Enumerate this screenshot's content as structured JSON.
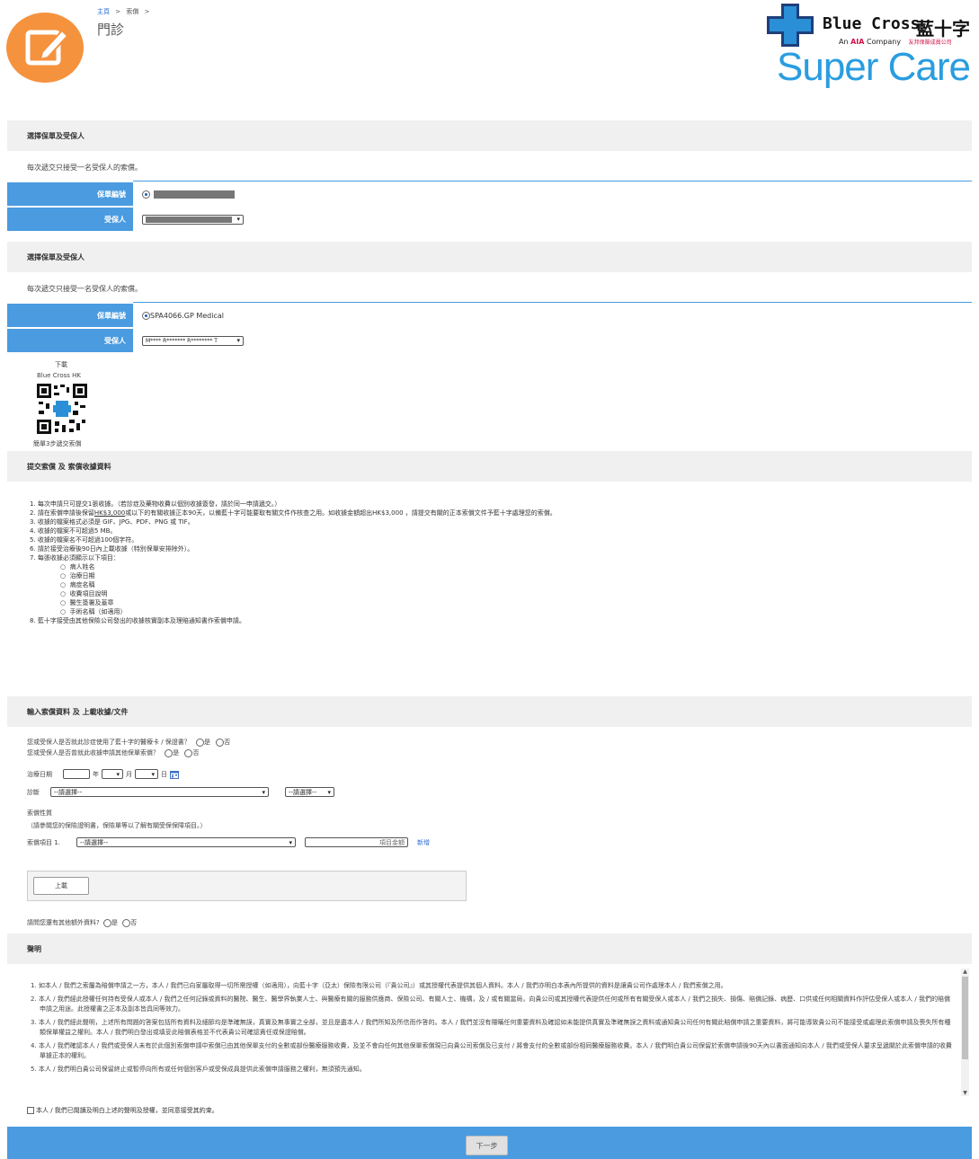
{
  "header": {
    "breadcrumb_home": "主頁",
    "breadcrumb_sep": ">",
    "breadcrumb_claims": "索償",
    "breadcrumb_sep2": ">",
    "page_title": "門診",
    "brand_name": "Blue Cross",
    "brand_cn": "藍十字",
    "brand_sub1": "An",
    "brand_sub_aia": "AIA",
    "brand_sub2": "Company",
    "brand_sub_cn": "友邦保險成員公司",
    "product": "Super Care"
  },
  "section1": {
    "heading": "選擇保單及受保人",
    "note": "每次遞交只接受一名受保人的索償。",
    "policy_label": "保單編號",
    "insured_label": "受保人"
  },
  "section2": {
    "heading": "選擇保單及受保人",
    "note": "每次遞交只接受一名受保人的索償。",
    "policy_label": "保單編號",
    "policy_value": "SPA4066.GP Medical",
    "insured_label": "受保人",
    "insured_value": "M**** R******* R******** T"
  },
  "app_promo": {
    "line1": "下載",
    "line2": "Blue Cross HK",
    "line3": "簡單3步遞交索償"
  },
  "section3": {
    "heading": "提交索償 及 索償收據資料",
    "items": [
      "1. 每次申請只可提交1張收據。（若診症及藥物收費以個別收據簽發，請於同一申請遞交。）",
      "3. 收據的檔案格式必須是 GIF、JPG、PDF、PNG 或 TIF。",
      "4. 收據的檔案不可超過5 MB。",
      "5. 收據的檔案名不可超過100個字符。",
      "6. 請於接受治療後90日內上載收據（特別保單安排除外）。",
      "7. 每張收據必須顯示以下項目："
    ],
    "item2_pre": "2. 請在索償申請後保留",
    "item2_link": "HK$3,000",
    "item2_post": "或以下的有關收據正本90天，以備藍十字可能要取有關文件作核查之用。如收據金額超出HK$3,000 ，請提交有關的正本索償文件予藍十字處理您的索償。",
    "subitems": [
      "病人姓名",
      "治療日期",
      "病症名稱",
      "收費項目說明",
      "醫生簽署及蓋章",
      "手術名稱（如適用）"
    ],
    "item8": "8. 藍十字接受由其他保險公司發出的收據核實副本及理賠通知書作索償申請。"
  },
  "section4": {
    "heading": "輸入索償資料 及 上載收據/文件",
    "q1": "您或受保人是否就此診症使用了藍十字的醫療卡 / 保證書？",
    "q2": "您或受保人是否曾就此收據申請其他保單索償？",
    "yes": "是",
    "no": "否",
    "date_label": "治療日期",
    "year": "年",
    "month": "月",
    "day": "日",
    "diagnosis_label": "診斷",
    "diag_placeholder": "--請選擇--",
    "diag2_placeholder": "--請選擇--",
    "claim_nature": "索償性質",
    "claim_hint": "（請參閱您的保險證明書，保險單等以了解有關受保保障項目。）",
    "claim_item_label": "索償項目 1.",
    "claim_item_placeholder": "--請選擇--",
    "amount_placeholder": "項目金額",
    "add_link": "新增",
    "upload": "上載",
    "extra_q": "請問您還有其他額外資料?",
    "extra_yes": "是",
    "extra_no": "否"
  },
  "section5": {
    "heading": "聲明",
    "paras": [
      "1. 如本人 / 我們之索屬為賠償申請之一方，本人 / 我們已向家屬取得一切所需授權（如適用），向藍十字（亞太）保險有限公司（『貴公司』）或其授權代表提供其個人資料。本人 / 我們亦明白本表內所提供的資料是讓貴公司作處理本人 / 我們索償之用。",
      "2. 本人 / 我們經此授權任何持有受保人或本人 / 我們之任何記錄或資料的醫院、醫生、醫學界執業人士、與醫療有關的服務供應商、保險公司、有關人士、機構，及 / 或有關當局，向貴公司或其授權代表提供任何或所有有關受保人或本人 / 我們之損失、損傷、賠償記錄、病歷、口供或任何相關資料作評估受保人或本人 / 我們的賠償申請之用途。此授權書之正本及副本皆具同等效力。",
      "3. 本人 / 我們經此聲明，上述所有問題的答案包括所有資料及細節均是準確無誤，真實及無事實之全部，並且是盡本人 / 我們所知及所信而作答的。本人 / 我們並沒有隱瞞任何重要資料及確認如未能提供真實及準確無誤之資料或通知貴公司任何有關此賠償申請之重要資料，將可能導致貴公司不能接受或處理此索償申請及喪失所有種類保單權益之權利。本人 / 我們明白發出或填妥此賠償表格並不代表貴公司確認責任或保證賠償。",
      "4. 本人 / 我們確認本人 / 我們或受保人未有於此個別索償申請中索償已由其他保單支付的全數或部份醫療服務收費，及並不會向任何其他保單索償現已向貴公司索償及已支付 / 將會支付的全數或部份相同醫療服務收費。本人 / 我們明白貴公司保留於索償申請後90天內以書面通知向本人 / 我們或受保人要求呈遞關於此索償申請的收費單據正本的權利。",
      "5. 本人 / 我們明白貴公司保留終止或暫停向所有或任何個別客戶或受保成員提供此索償申請服務之權利，無須預先通知。"
    ],
    "agree": "本人 / 我們已閱讀及明白上述的聲明及授權，並同意接受其約束。"
  },
  "footer": {
    "next": "下一步"
  },
  "colors": {
    "accent": "#4a9be0",
    "orange": "#f5923e",
    "brand_blue": "#2a8fd6",
    "link": "#2b6cd3"
  }
}
